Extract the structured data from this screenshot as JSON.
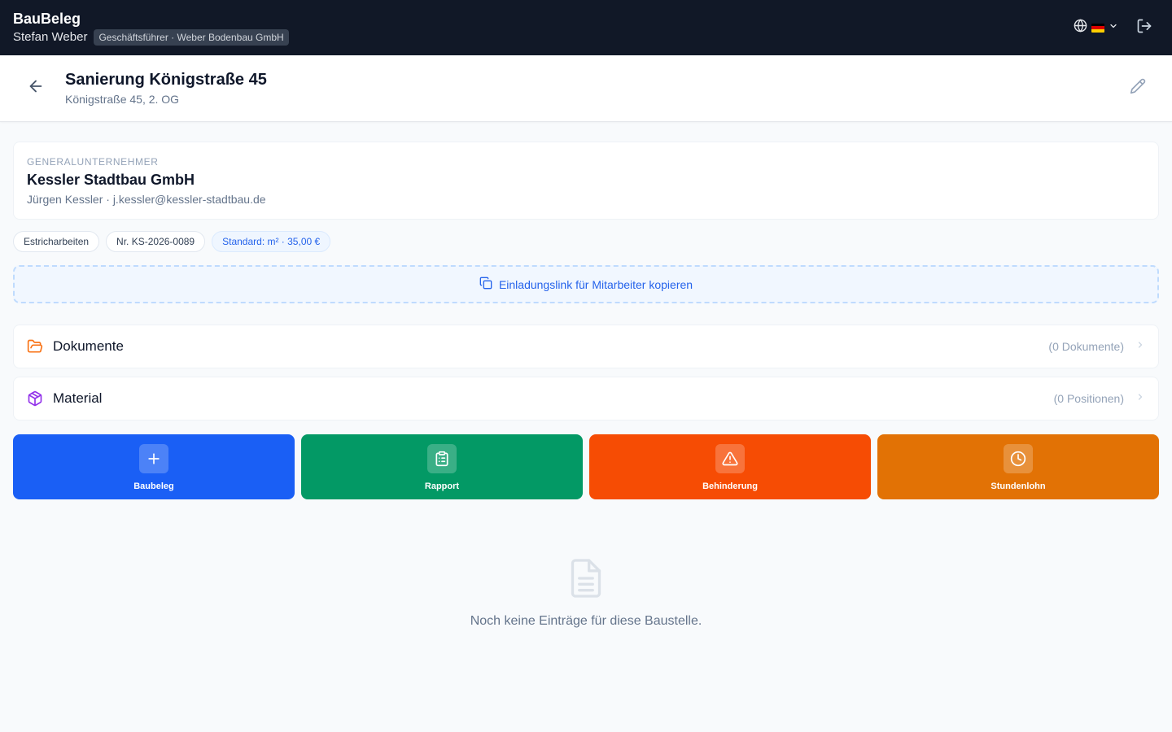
{
  "app": {
    "title": "BauBeleg"
  },
  "user": {
    "name": "Stefan Weber",
    "role": "Geschäftsführer · Weber Bodenbau GmbH"
  },
  "topbar": {
    "globe_icon": "globe-icon",
    "flag_icon": "flag-de-icon",
    "logout_icon": "logout-icon"
  },
  "project": {
    "title": "Sanierung Königstraße 45",
    "address": "Königstraße 45, 2. OG"
  },
  "general_contractor": {
    "label": "GENERALUNTERNEHMER",
    "name": "Kessler Stadtbau GmbH",
    "contact": "Jürgen Kessler · j.kessler@kessler-stadtbau.de"
  },
  "tags": [
    "Estricharbeiten",
    "Nr. KS-2026-0089",
    "Standard: m² · 35,00 €"
  ],
  "invite": {
    "label": "Einladungslink für Mitarbeiter kopieren"
  },
  "sections": [
    {
      "title": "Dokumente",
      "count": "(0 Dokumente)",
      "icon": "folder-icon",
      "color": "#f97316"
    },
    {
      "title": "Material",
      "count": "(0 Positionen)",
      "icon": "package-icon",
      "color": "#9333ea"
    }
  ],
  "actions": [
    {
      "label": "Baubeleg",
      "icon": "plus-icon",
      "color": "#1a5ff5"
    },
    {
      "label": "Rapport",
      "icon": "clipboard-icon",
      "color": "#039965"
    },
    {
      "label": "Behinderung",
      "icon": "warning-icon",
      "color": "#f64c04"
    },
    {
      "label": "Stundenlohn",
      "icon": "clock-icon",
      "color": "#e27205"
    }
  ],
  "empty_state": {
    "text": "Noch keine Einträge für diese Baustelle.",
    "icon": "document-icon"
  }
}
